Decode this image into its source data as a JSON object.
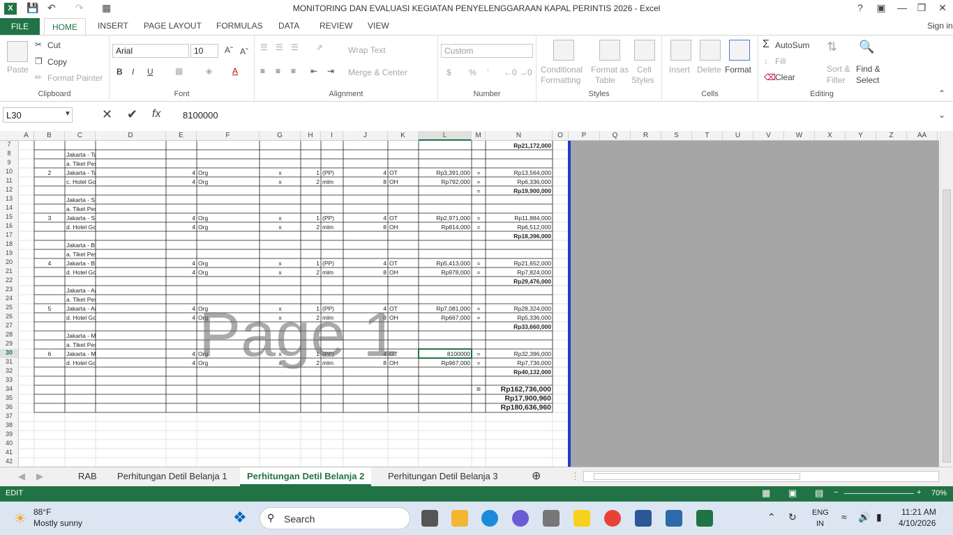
{
  "window": {
    "title": "MONITORING DAN EVALUASI KEGIATAN PENYELENGGARAAN KAPAL PERINTIS 2026 - Excel",
    "help": "?",
    "signin": "Sign in"
  },
  "ribbon_tabs": [
    "FILE",
    "HOME",
    "INSERT",
    "PAGE LAYOUT",
    "FORMULAS",
    "DATA",
    "REVIEW",
    "VIEW"
  ],
  "clipboard": {
    "paste": "Paste",
    "cut": "Cut",
    "copy": "Copy",
    "format_painter": "Format Painter",
    "label": "Clipboard"
  },
  "font": {
    "name": "Arial",
    "size": "10",
    "label": "Font",
    "bold": "B",
    "italic": "I",
    "underline": "U"
  },
  "alignment": {
    "wrap": "Wrap Text",
    "merge": "Merge & Center",
    "label": "Alignment"
  },
  "number": {
    "format": "Custom",
    "label": "Number",
    "currency": "$",
    "percent": "%",
    "comma": "’"
  },
  "styles": {
    "conditional": "Conditional",
    "conditional2": "Formatting",
    "format_as": "Format as",
    "table": "Table",
    "cell": "Cell",
    "cell2": "Styles",
    "label": "Styles"
  },
  "cells": {
    "insert": "Insert",
    "delete": "Delete",
    "format": "Format",
    "label": "Cells"
  },
  "editing": {
    "autosum": "AutoSum",
    "fill": "Fill",
    "clear": "Clear",
    "sort": "Sort &",
    "sort2": "Filter",
    "find": "Find &",
    "find2": "Select",
    "label": "Editing"
  },
  "formula_bar": {
    "name_box": "L30",
    "value": "8100000",
    "fx": "fx"
  },
  "columns": [
    "A",
    "B",
    "C",
    "D",
    "E",
    "F",
    "G",
    "H",
    "I",
    "J",
    "K",
    "L",
    "M",
    "N",
    "O",
    "P",
    "Q",
    "R",
    "S",
    "T",
    "U",
    "V",
    "W",
    "X",
    "Y",
    "Z",
    "AA"
  ],
  "rows": [
    "7",
    "8",
    "9",
    "10",
    "11",
    "12",
    "13",
    "14",
    "15",
    "16",
    "17",
    "18",
    "19",
    "20",
    "21",
    "22",
    "23",
    "24",
    "25",
    "26",
    "27",
    "28",
    "29",
    "30",
    "31",
    "32",
    "33",
    "34",
    "35",
    "36",
    "37",
    "38",
    "39",
    "40",
    "41",
    "42"
  ],
  "cells_data": [
    {
      "row": "7",
      "N": "Rp21,172,000",
      "bold": true
    },
    {
      "row": "8",
      "C": "Jakarta - Tanjung Pinang"
    },
    {
      "row": "9",
      "C": "a. Tiket Pesawat"
    },
    {
      "row": "10",
      "B": "2",
      "C": "Jakarta - Tanjung Pinang",
      "E": "4",
      "F": "Org",
      "G": "x",
      "H": "1",
      "I": "(PP)",
      "J": "4",
      "K": "OT",
      "L": "Rp3,391,000",
      "M": "=",
      "N": "Rp13,564,000"
    },
    {
      "row": "11",
      "C": "c. Hotel Gol.III",
      "E": "4",
      "F": "Org",
      "G": "x",
      "H": "2",
      "I": "mlm",
      "J": "8",
      "K": "OH",
      "L": "Rp792,000",
      "M": "=",
      "N": "Rp6,336,000"
    },
    {
      "row": "12",
      "M": "=",
      "N": "Rp19,900,000",
      "bold": true
    },
    {
      "row": "13",
      "C": "Jakarta - Surabaya"
    },
    {
      "row": "14",
      "C": "a. Tiket Pesawat"
    },
    {
      "row": "15",
      "B": "3",
      "C": "Jakarta - Surabaya",
      "E": "4",
      "F": "Org",
      "G": "x",
      "H": "1",
      "I": "(PP)",
      "J": "4",
      "K": "OT",
      "L": "Rp2,971,000",
      "M": "=",
      "N": "Rp11,884,000"
    },
    {
      "row": "16",
      "C": "d. Hotel Gol.III",
      "E": "4",
      "F": "Org",
      "G": "x",
      "H": "2",
      "I": "mlm",
      "J": "8",
      "K": "OH",
      "L": "Rp814,000",
      "M": "=",
      "N": "Rp6,512,000"
    },
    {
      "row": "17",
      "N": "Rp18,396,000",
      "bold": true
    },
    {
      "row": "18",
      "C": "Jakarta - Bitung"
    },
    {
      "row": "19",
      "C": "a. Tiket Pesawat"
    },
    {
      "row": "20",
      "B": "4",
      "C": "Jakarta - Bitung",
      "E": "4",
      "F": "Org",
      "G": "x",
      "H": "1",
      "I": "(PP)",
      "J": "4",
      "K": "OT",
      "L": "Rp5,413,000",
      "M": "=",
      "N": "Rp21,652,000"
    },
    {
      "row": "21",
      "C": "d. Hotel Gol.III",
      "E": "4",
      "F": "Org",
      "G": "x",
      "H": "2",
      "I": "mlm",
      "J": "8",
      "K": "OH",
      "L": "Rp978,000",
      "M": "=",
      "N": "Rp7,824,000"
    },
    {
      "row": "22",
      "N": "Rp29,476,000",
      "bold": true
    },
    {
      "row": "23",
      "C": "Jakarta - Ambon"
    },
    {
      "row": "24",
      "C": "a. Tiket Pesawat"
    },
    {
      "row": "25",
      "B": "5",
      "C": "Jakarta - Ambon",
      "E": "4",
      "F": "Org",
      "G": "x",
      "H": "1",
      "I": "(PP)",
      "J": "4",
      "K": "OT",
      "L": "Rp7,081,000",
      "M": "=",
      "N": "Rp28,324,000"
    },
    {
      "row": "26",
      "C": "d. Hotel Gol.III",
      "E": "4",
      "F": "Org",
      "G": "x",
      "H": "2",
      "I": "mlm",
      "J": "8",
      "K": "OH",
      "L": "Rp667,000",
      "M": "=",
      "N": "Rp5,336,000"
    },
    {
      "row": "27",
      "N": "Rp33,660,000",
      "bold": true
    },
    {
      "row": "28",
      "C": "Jakarta - Merauke"
    },
    {
      "row": "29",
      "C": "a. Tiket Pesawat"
    },
    {
      "row": "30",
      "B": "6",
      "C": "Jakarta - Merauke",
      "E": "4",
      "F": "Org",
      "G": "x",
      "H": "1",
      "I": "(PP)",
      "J": "4",
      "K": "OT",
      "L": "8100000",
      "M": "=",
      "N": "Rp32,396,000"
    },
    {
      "row": "31",
      "C": "d. Hotel Gol.III",
      "E": "4",
      "F": "Org",
      "G": "x",
      "H": "2",
      "I": "mlm",
      "J": "8",
      "K": "OH",
      "L": "Rp967,000",
      "M": "=",
      "N": "Rp7,736,000"
    },
    {
      "row": "32",
      "N": "Rp40,132,000",
      "bold": true
    },
    {
      "row": "34",
      "M": "=",
      "N": "Rp162,736,000",
      "big": true
    },
    {
      "row": "35",
      "N": "Rp17,900,960",
      "big": true
    },
    {
      "row": "36",
      "N": "Rp180,636,960",
      "big": true
    }
  ],
  "watermark": "Page 1",
  "sheet_tabs": [
    "RAB",
    "Perhitungan Detil Belanja 1",
    "Perhitungan Detil Belanja 2",
    "Perhitungan Detil Belanja 3"
  ],
  "active_sheet": "Perhitungan Detil Belanja 2",
  "status": {
    "mode": "EDIT",
    "zoom": "70%"
  },
  "taskbar": {
    "temp": "88°F",
    "weather": "Mostly sunny",
    "search": "Search",
    "lang1": "ENG",
    "lang2": "IN",
    "time": "11:21 AM",
    "date": "4/10/2026"
  },
  "colors": {
    "excel_green": "#217346",
    "page_break": "#1c3ecc"
  }
}
